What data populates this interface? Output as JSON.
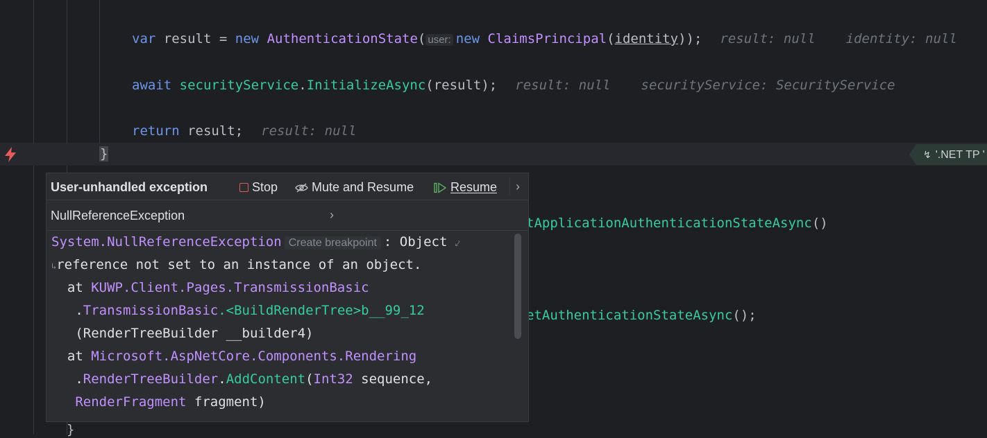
{
  "code": {
    "line1": {
      "kw_var": "var",
      "result": "result",
      "eq": "=",
      "kw_new": "new",
      "type_auth": "AuthenticationState",
      "paren_open": "(",
      "inlay_user": "user:",
      "kw_new2": "new",
      "type_claims": "ClaimsPrincipal",
      "paren2": "(",
      "identity": "identity",
      "close": "));",
      "hint1": "result: null",
      "hint2": "identity: null"
    },
    "line2": {
      "kw_await": "await",
      "service": "securityService",
      "dot": ".",
      "method": "InitializeAsync",
      "args": "(result);",
      "hint1": "result: null",
      "hint2": "securityService: SecurityService"
    },
    "line3": {
      "kw_return": "return",
      "rest": "result;",
      "hint1": "result: null"
    },
    "line4": {
      "brace": "}"
    },
    "line5": {
      "method": "tApplicationAuthenticationStateAsync",
      "tail": "()"
    },
    "line6": {
      "method": "etAuthenticationStateAsync",
      "tail": "();"
    },
    "line7": {
      "brace": "}"
    }
  },
  "badge": {
    "icon": "net-tp-icon",
    "label": "'.NET TP '"
  },
  "popup": {
    "title": "User-unhandled exception",
    "stop_label": "Stop",
    "mute_label": "Mute and Resume",
    "resume_label": "Resume",
    "exception_name": "NullReferenceException",
    "trace": {
      "l1_type": "System.NullReferenceException",
      "create_breakpoint": "Create breakpoint",
      "l1_rest": ": Object",
      "l2": "reference not set to an instance of an object.",
      "l3_at": "  at ",
      "l3_type": "KUWP.Client.Pages.TransmissionBasic",
      "l4_dot": "   .",
      "l4_type": "TransmissionBasic",
      "l4_method": ".<BuildRenderTree>b__99_12",
      "l5": "   (RenderTreeBuilder __builder4)",
      "l6_at": "  at ",
      "l6_type": "Microsoft.AspNetCore.Components.Rendering",
      "l7_dot": "   .",
      "l7_type": "RenderTreeBuilder",
      "l7_dot2": ".",
      "l7_method": "AddContent",
      "l7_paren": "(",
      "l7_type2": "Int32",
      "l7_rest": " sequence,",
      "l8_type": "   RenderFragment",
      "l8_rest": " fragment)"
    }
  }
}
